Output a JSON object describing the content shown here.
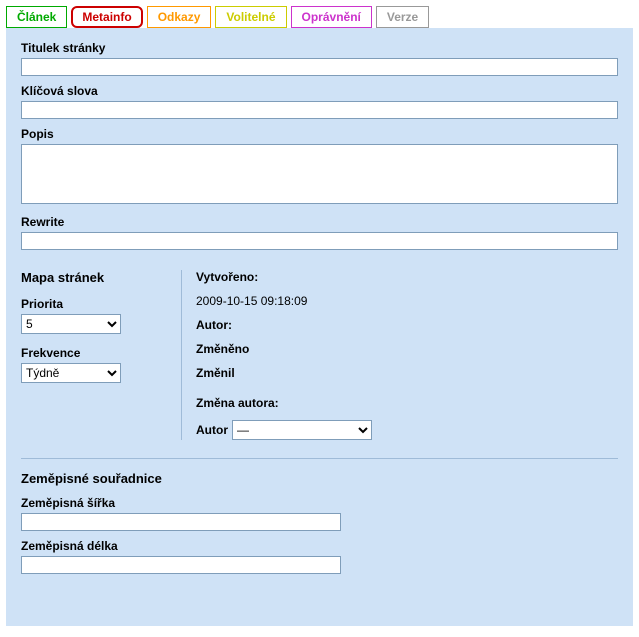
{
  "tabs": {
    "clanek": "Článek",
    "metainfo": "Metainfo",
    "odkazy": "Odkazy",
    "volitelne": "Volitelné",
    "opravneni": "Oprávnění",
    "verze": "Verze"
  },
  "fields": {
    "titulek_label": "Titulek stránky",
    "titulek_value": "",
    "klicova_label": "Klíčová slova",
    "klicova_value": "",
    "popis_label": "Popis",
    "popis_value": "",
    "rewrite_label": "Rewrite",
    "rewrite_value": ""
  },
  "sitemap": {
    "title": "Mapa stránek",
    "priorita_label": "Priorita",
    "priorita_value": "5",
    "frekvence_label": "Frekvence",
    "frekvence_value": "Týdně"
  },
  "meta": {
    "vytvoreno_label": "Vytvořeno:",
    "vytvoreno_value": "2009-10-15 09:18:09",
    "autor_label": "Autor:",
    "autor_value": "",
    "zmeneno_label": "Změněno",
    "zmeneno_value": "",
    "zmenil_label": "Změnil",
    "zmenil_value": "",
    "zmena_autora_label": "Změna autora:",
    "autor_select_label": "Autor",
    "autor_select_value": "—"
  },
  "geo": {
    "title": "Zeměpisné souřadnice",
    "sirka_label": "Zeměpisná šířka",
    "sirka_value": "",
    "delka_label": "Zeměpisná délka",
    "delka_value": ""
  }
}
